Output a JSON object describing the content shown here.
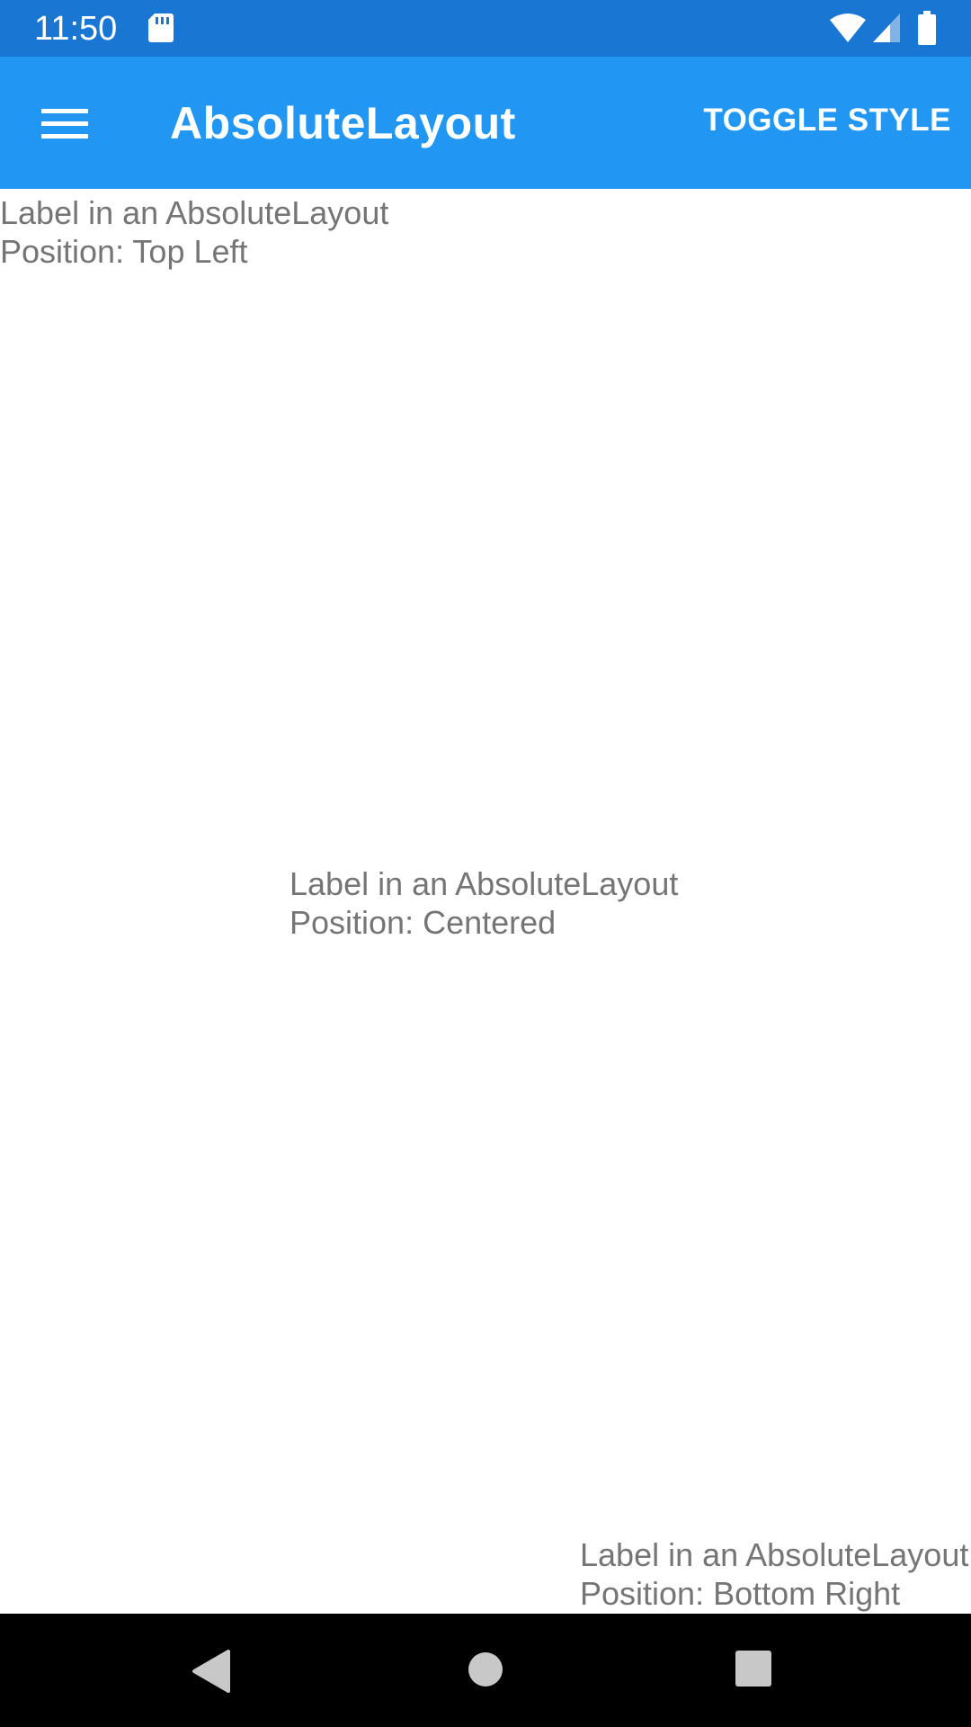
{
  "status_bar": {
    "time": "11:50",
    "icons": [
      "sd-card-icon",
      "wifi-icon",
      "cell-signal-icon",
      "battery-icon"
    ]
  },
  "app_bar": {
    "title": "AbsoluteLayout",
    "menu_icon": "hamburger-menu-icon",
    "action_label": "TOGGLE STYLE"
  },
  "labels": [
    {
      "line1": "Label in an AbsoluteLayout",
      "line2": "Position: Top Left"
    },
    {
      "line1": "Label in an AbsoluteLayout",
      "line2": "Position: Centered"
    },
    {
      "line1": "Label in an AbsoluteLayout",
      "line2": "Position: Bottom Right"
    }
  ],
  "nav_bar": {
    "icons": [
      "back-icon",
      "home-icon",
      "recents-icon"
    ]
  },
  "colors": {
    "status_bar": "#1976d2",
    "app_bar": "#2196f3",
    "label_text": "#757575",
    "nav_bar": "#000000"
  }
}
